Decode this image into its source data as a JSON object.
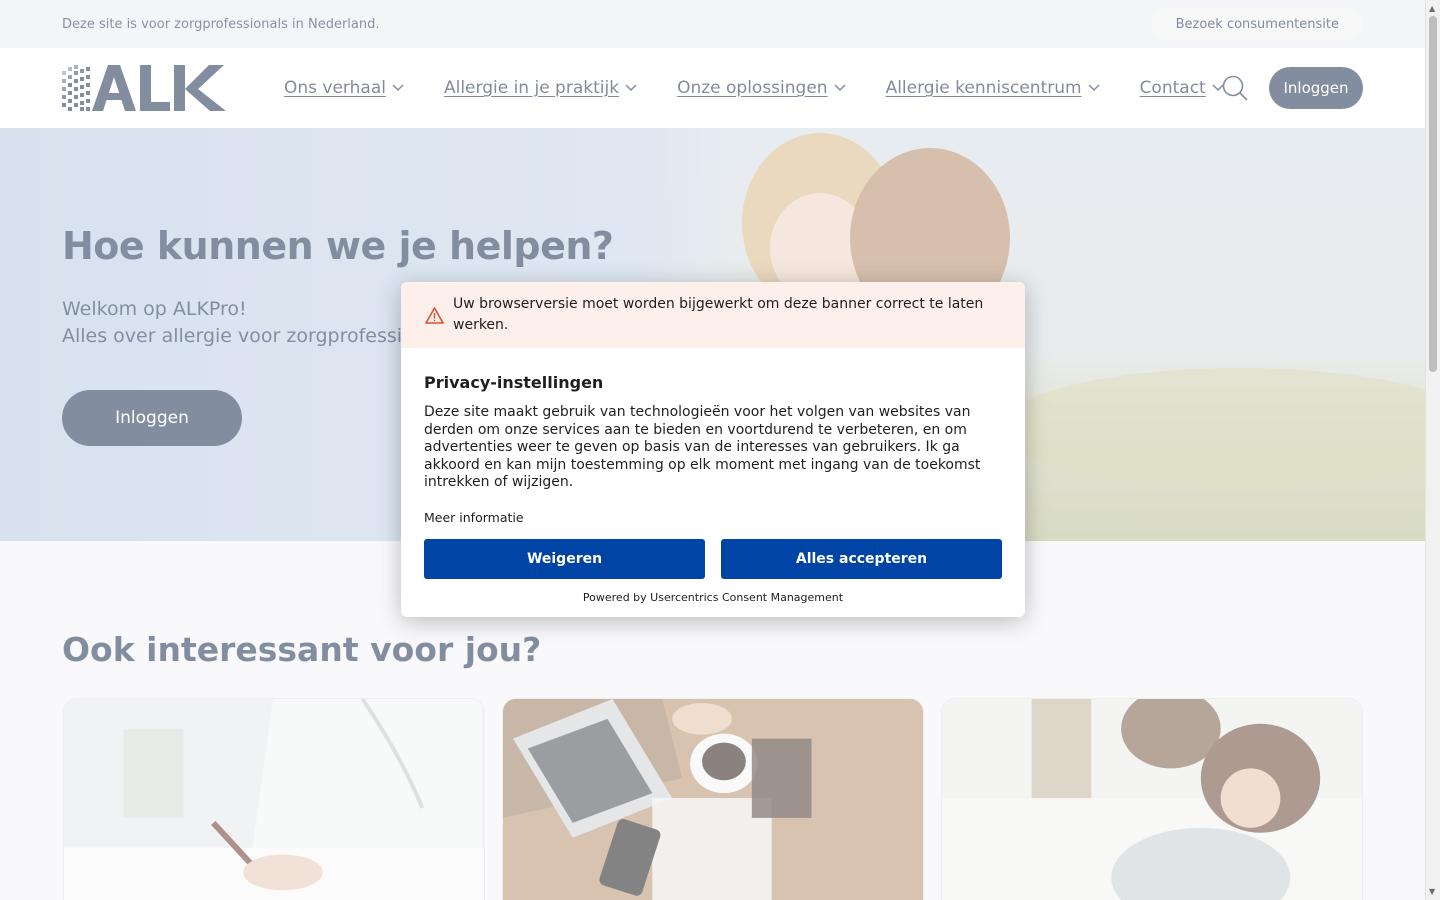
{
  "topbar": {
    "notice": "Deze site is voor zorgprofessionals in Nederland.",
    "consumer_button": "Bezoek consumentensite"
  },
  "header": {
    "logo_text": "ALK",
    "nav": [
      {
        "label": "Ons verhaal"
      },
      {
        "label": "Allergie in je praktijk"
      },
      {
        "label": "Onze oplossingen"
      },
      {
        "label": "Allergie kenniscentrum"
      },
      {
        "label": "Contact"
      }
    ],
    "search_icon": "search-icon",
    "login_label": "Inloggen"
  },
  "hero": {
    "title": "Hoe kunnen we je helpen?",
    "subtitle_line1": "Welkom op ALKPro!",
    "subtitle_line2": "Alles over allergie voor zorgprofessionals",
    "login_label": "Inloggen"
  },
  "section": {
    "title": "Ook interessant voor jou?"
  },
  "cookie_modal": {
    "warning": "Uw browserversie moet worden bijgewerkt om deze banner correct te laten werken.",
    "title": "Privacy-instellingen",
    "body": "Deze site maakt gebruik van technologieën voor het volgen van websites van derden om onze services aan te bieden en voortdurend te verbeteren, en om advertenties weer te geven op basis van de interesses van gebruikers. Ik ga akkoord en kan mijn toestemming op elk moment met ingang van de toekomst intrekken of wijzigen.",
    "more_info": "Meer informatie",
    "refuse": "Weigeren",
    "accept": "Alles accepteren",
    "powered_by": "Powered by Usercentrics Consent Management"
  },
  "colors": {
    "primary_navy": "#1d3252",
    "consent_blue": "#0045a5",
    "warning_bg": "#fdf0eb",
    "warning_icon": "#e0502a"
  }
}
